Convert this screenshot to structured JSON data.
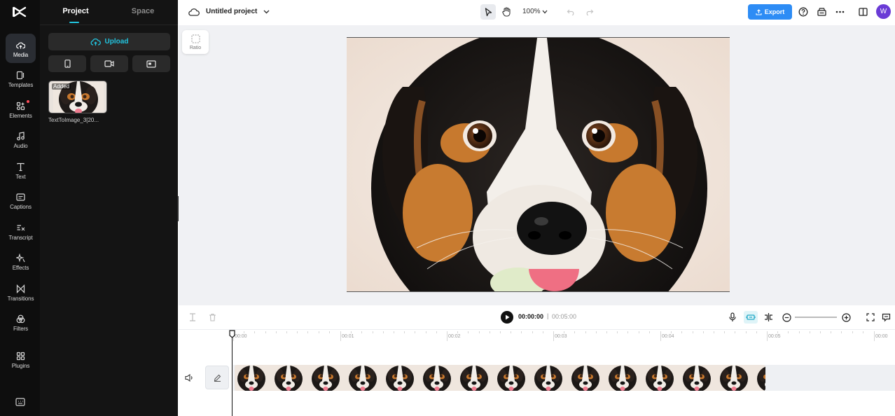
{
  "sidebar": {
    "items": [
      {
        "label": "Media",
        "icon": "cloud-upload-icon",
        "active": true
      },
      {
        "label": "Templates",
        "icon": "templates-icon"
      },
      {
        "label": "Elements",
        "icon": "elements-icon",
        "badge": true
      },
      {
        "label": "Audio",
        "icon": "music-note-icon"
      },
      {
        "label": "Text",
        "icon": "text-icon"
      },
      {
        "label": "Captions",
        "icon": "captions-icon"
      },
      {
        "label": "Transcript",
        "icon": "transcript-icon"
      },
      {
        "label": "Effects",
        "icon": "sparkle-icon"
      },
      {
        "label": "Transitions",
        "icon": "transitions-icon"
      },
      {
        "label": "Filters",
        "icon": "filters-icon"
      },
      {
        "label": "Plugins",
        "icon": "plugins-grid-icon"
      }
    ],
    "bottom_icon": "keyboard-icon"
  },
  "panel": {
    "tabs": [
      {
        "label": "Project",
        "active": true
      },
      {
        "label": "Space",
        "active": false
      }
    ],
    "upload_label": "Upload",
    "source_buttons": [
      "phone-icon",
      "camera-icon",
      "screen-record-icon"
    ],
    "media": [
      {
        "badge": "Added",
        "name": "TextToImage_3[20..."
      }
    ]
  },
  "topbar": {
    "project_title": "Untitled project",
    "zoom": "100%",
    "export_label": "Export",
    "avatar_initial": "W"
  },
  "canvas": {
    "ratio_label": "Ratio"
  },
  "playback": {
    "current_time": "00:00:00",
    "separator": "|",
    "total_time": "00:05:00"
  },
  "timeline": {
    "ticks": [
      "00:00",
      "00:01",
      "00:02",
      "00:03",
      "00:04",
      "00:05",
      "00:00"
    ],
    "frame_count": 15
  },
  "colors": {
    "accent": "#22c5e0",
    "export": "#2d8cf5",
    "avatar": "#6a3bd6"
  }
}
